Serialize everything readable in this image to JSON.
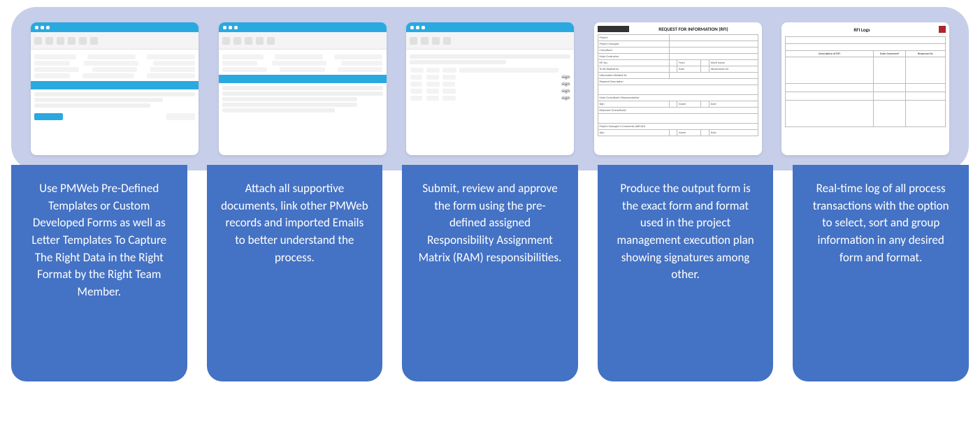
{
  "cards": [
    "Use PMWeb Pre-Defined Templates or Custom Developed Forms as well as Letter Templates To Capture The Right Data in the Right Format by the Right Team Member.",
    "Attach all supportive documents, link other PMWeb records and imported Emails to better understand the process.",
    "Submit, review and approve the form using the pre-defined assigned Responsibility Assignment Matrix (RAM) responsibilities.",
    "Produce the output form is the exact form and format used in the project management execution plan showing signatures among other.",
    "Real-time log of all process transactions with the option to select, sort and group information in any desired form and format."
  ],
  "thumbs": {
    "t1": {
      "kind": "form",
      "title_note": "PMWeb template form"
    },
    "t2": {
      "kind": "attachments",
      "title_note": "Attachments panel"
    },
    "t3": {
      "kind": "workflow",
      "title_note": "Workflow list"
    },
    "t4": {
      "kind": "rfi-doc",
      "title_note": "Request for Information form",
      "header": "REQUEST FOR INFORMATION (RFI)",
      "left_labels": [
        "Project",
        "Project Manager",
        "Consultant",
        "Main Contractor",
        "RFI No.",
        "To Be Replied by",
        "Information Related To:"
      ],
      "sections": [
        "Request Description",
        "Main Consultant's Representative",
        "Response (Consultant)",
        "Project Manager's Comments (ARCAN)"
      ],
      "right_labels": [
        "From",
        "Date",
        "Work Name",
        "Attachment for"
      ],
      "sign_fields": [
        "Sign",
        "Name",
        "Date"
      ]
    },
    "t5": {
      "kind": "log-doc",
      "title_note": "RFI Logs",
      "header": "RFI Logs",
      "cols": [
        "Description of RFI",
        "Date Answered",
        "Response by"
      ]
    }
  }
}
